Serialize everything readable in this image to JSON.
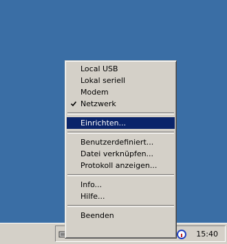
{
  "taskbar": {
    "clock": "15:40",
    "tray_icons": [
      "network-icon",
      "connection-icon",
      "connection-icon",
      "connection-icon",
      "connection-icon",
      "connection-icon",
      "monitor-icon",
      "info-icon"
    ]
  },
  "menu": {
    "items": [
      {
        "label": "Local USB",
        "checked": false
      },
      {
        "label": "Lokal seriell",
        "checked": false
      },
      {
        "label": "Modem",
        "checked": false
      },
      {
        "label": "Netzwerk",
        "checked": true
      },
      {
        "label": "Einrichten...",
        "selected": true
      },
      {
        "label": "Benutzerdefiniert..."
      },
      {
        "label": "Datei verknüpfen..."
      },
      {
        "label": "Protokoll anzeigen..."
      },
      {
        "label": "Info..."
      },
      {
        "label": "Hilfe..."
      },
      {
        "label": "Beenden"
      }
    ]
  },
  "colors": {
    "desktop": "#3a6ea5",
    "menu_bg": "#d4d0c8",
    "selection": "#0a246a"
  }
}
